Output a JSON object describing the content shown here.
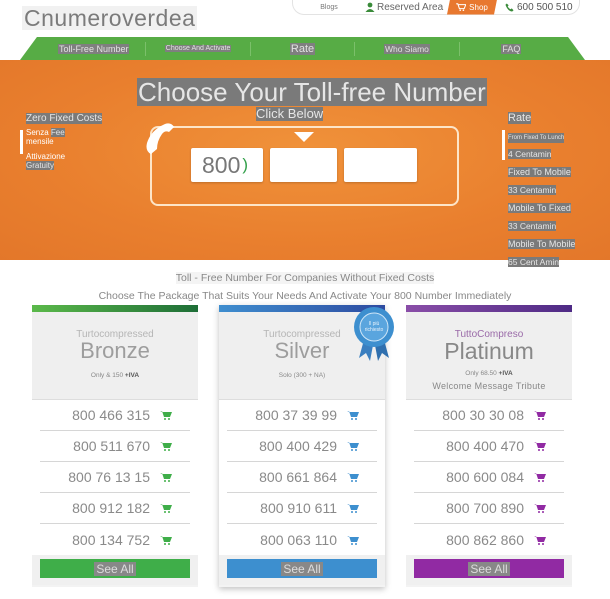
{
  "header": {
    "logo": "Cnumeroverdea",
    "topbar": {
      "blog": "Blogs",
      "reserved_area": "Reserved Area",
      "shop": "Shop",
      "phone": "600 500 510"
    },
    "nav": [
      {
        "label": "Toll-Free Number"
      },
      {
        "label": "Choose And Activate"
      },
      {
        "label": "Rate"
      },
      {
        "label": "Who Siamo"
      },
      {
        "label": "FAQ"
      }
    ]
  },
  "hero": {
    "title": "Choose Your Toll-free Number",
    "subtitle": "Click Below",
    "left": {
      "heading": "Zero Fixed Costs",
      "line1a": "Senza",
      "line1b": "Fee",
      "line1c": "mensile",
      "line2a": "Attivazione",
      "line2b": "Gratuity"
    },
    "right": {
      "heading": "Rate",
      "rates": [
        {
          "label": "From Fixed To Lunch",
          "value": "4 Centamin"
        },
        {
          "label": "Fixed To Mobile",
          "value": "33 Centamin"
        },
        {
          "label": "Mobile To Fixed",
          "value": "33 Centamin"
        },
        {
          "label": "Mobile To Mobile",
          "value": "65 Cent Amin"
        }
      ]
    },
    "number_fields": {
      "prefix": "800",
      "part2": "",
      "part3": ""
    }
  },
  "intro": {
    "line1": "Toll - Free Number For Companies Without Fixed Costs",
    "line2": "Choose The Package That Suits Your Needs And Activate Your 800 Number Immediately"
  },
  "packages": [
    {
      "kicker": "Turtocompressed",
      "name": "Bronze",
      "price": "Only & 150",
      "tax": "+IVA",
      "extra": "",
      "accent": "#3fae49",
      "numbers": [
        "800 466 315",
        "800 511 670",
        "800 76 13 15",
        "800 912 182",
        "800 134 752"
      ],
      "see_all": "See All"
    },
    {
      "kicker": "Turtocompressed",
      "name": "Silver",
      "price": "Solo (300 + NA)",
      "tax": "",
      "extra": "",
      "badge": "Il più richiesto",
      "accent": "#3d8fcf",
      "numbers": [
        "800 37 39 99",
        "800 400 429",
        "800 661 864",
        "800 910 611",
        "800 063 110"
      ],
      "see_all": "See All"
    },
    {
      "kicker": "TuttoCompreso",
      "name": "Platinum",
      "price": "Only 68.50",
      "tax": "+IVA",
      "extra": "Welcome Message Tribute",
      "accent": "#912aa3",
      "numbers": [
        "800 30 30 08",
        "800 400 470",
        "800 600 084",
        "800 700 890",
        "800 862 860"
      ],
      "see_all": "See All"
    }
  ]
}
